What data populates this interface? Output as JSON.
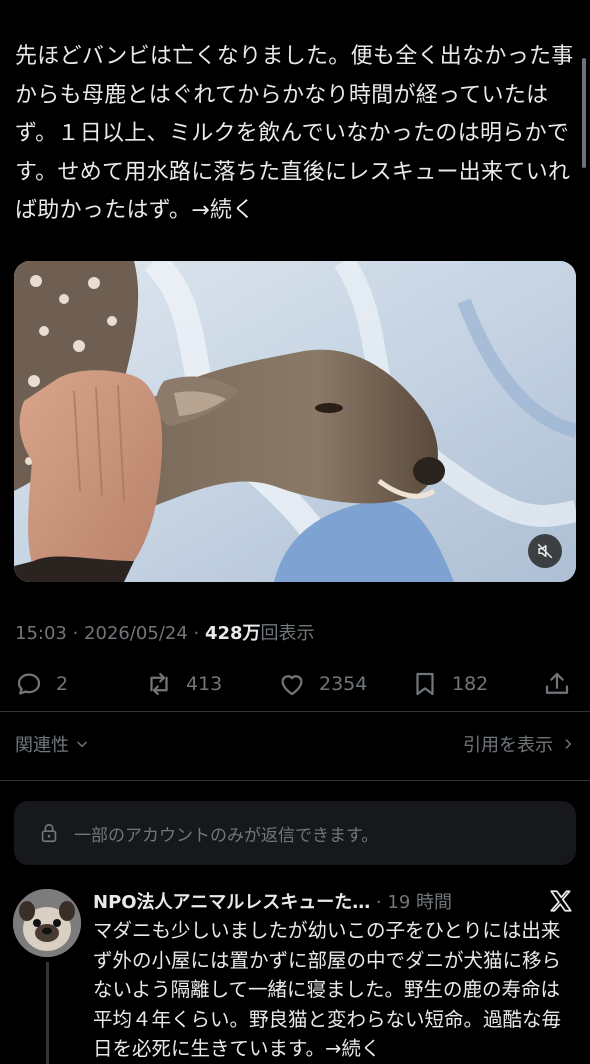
{
  "post": {
    "text": "先ほどバンビは亡くなりました。便も全く出なかった事からも母鹿とはぐれてからかなり時間が経っていたはず。１日以上、ミルクを飲んでいなかったのは明らかです。せめて用水路に落ちた直後にレスキュー出来ていれば助かったはず。→続く",
    "media_alt": "Fawn lying on a light blue blanket while a hand strokes its head",
    "meta_time": "15:03 · 2026/05/24 · ",
    "meta_views": "428万",
    "meta_views_suffix": "回表示"
  },
  "actions": {
    "replies": "2",
    "reposts": "413",
    "likes": "2354",
    "bookmarks": "182"
  },
  "sort": {
    "label": "関連性",
    "quotes_label": "引用を表示"
  },
  "reply_notice": "一部のアカウントのみが返信できます。",
  "reply": {
    "name": "NPO法人アニマルレスキューた…",
    "time": " · 19 時間",
    "text": "マダニも少しいましたが幼いこの子をひとりには出来ず外の小屋には置かずに部屋の中でダニが犬猫に移らないよう隔離して一緒に寝ました。野生の鹿の寿命は平均４年くらい。野良猫と変わらない短命。過酷な毎日を必死に生きています。→続く"
  },
  "colors": {
    "text_primary": "#e7e9ea",
    "text_secondary": "#71767b",
    "background": "#000000",
    "divider": "#2f3336"
  },
  "icons": [
    "reply-icon",
    "repost-icon",
    "like-icon",
    "bookmark-icon",
    "share-icon",
    "chevron-down-icon",
    "chevron-right-icon",
    "lock-icon",
    "mute-icon",
    "x-logo"
  ]
}
